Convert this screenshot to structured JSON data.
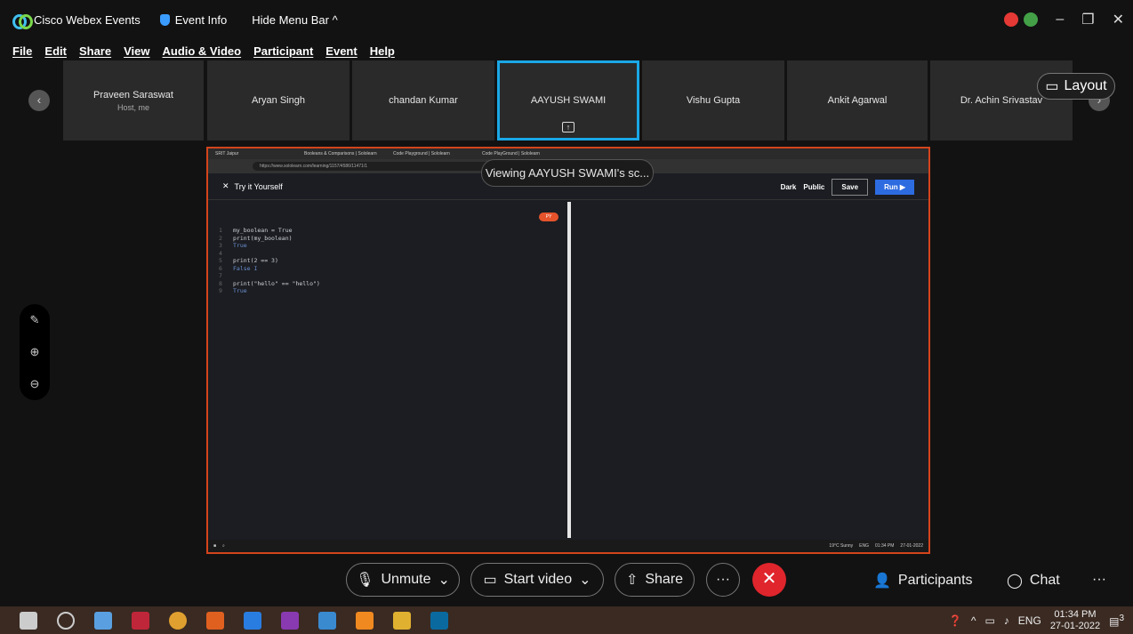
{
  "titlebar": {
    "app_name": "Cisco Webex Events",
    "event_info": "Event Info",
    "hide_menu": "Hide Menu Bar ^"
  },
  "window_controls": {
    "minimize": "–",
    "restore": "❐",
    "close": "✕"
  },
  "menu": [
    "File",
    "Edit",
    "Share",
    "View",
    "Audio & Video",
    "Participant",
    "Event",
    "Help"
  ],
  "participants": [
    {
      "name": "Praveen Saraswat",
      "sub": "Host, me"
    },
    {
      "name": "Aryan Singh",
      "sub": ""
    },
    {
      "name": "chandan Kumar",
      "sub": ""
    },
    {
      "name": "AAYUSH SWAMI",
      "sub": "",
      "active": true
    },
    {
      "name": "Vishu Gupta",
      "sub": ""
    },
    {
      "name": "Ankit Agarwal",
      "sub": ""
    },
    {
      "name": "Dr. Achin Srivastav",
      "sub": ""
    }
  ],
  "layout_label": "Layout",
  "viewing_banner": "Viewing AAYUSH SWAMI's sc...",
  "shared_screen": {
    "tabs": [
      "SRIT Jaipur",
      "Booleans & Comparisons | Sololearn",
      "Code Playground | Sololearn",
      "Code PlayGround | Sololearn"
    ],
    "url": "https://www.sololearn.com/learning/1157/4586/11471/1",
    "header_title": "Try it Yourself",
    "toggle_dark": "Dark",
    "toggle_public": "Public",
    "save_label": "Save",
    "run_label": "Run ▶",
    "lang_badge": "PY",
    "code": [
      {
        "n": "1",
        "text": "my_boolean = True"
      },
      {
        "n": "2",
        "text": "print(my_boolean)"
      },
      {
        "n": "3",
        "text": "True"
      },
      {
        "n": "4",
        "text": ""
      },
      {
        "n": "5",
        "text": "print(2 == 3)"
      },
      {
        "n": "6",
        "text": "False  I"
      },
      {
        "n": "7",
        "text": ""
      },
      {
        "n": "8",
        "text": "print(\"hello\" == \"hello\")"
      },
      {
        "n": "9",
        "text": "True"
      }
    ],
    "tray_text": "19°C Sunny",
    "tray_lang": "ENG",
    "tray_time": "01:34 PM",
    "tray_date": "27-01-2022"
  },
  "controls": {
    "unmute": "Unmute",
    "start_video": "Start video",
    "share": "Share",
    "more": "···",
    "end": "✕",
    "participants": "Participants",
    "chat": "Chat",
    "overflow": "···"
  },
  "taskbar": {
    "lang": "ENG",
    "time": "01:34 PM",
    "date": "27-01-2022",
    "notif_count": "3"
  },
  "colors": {
    "active_tile": "#1aa7e6",
    "share_border": "#d4441c",
    "end_call": "#e0252c",
    "run": "#2d6be0"
  }
}
